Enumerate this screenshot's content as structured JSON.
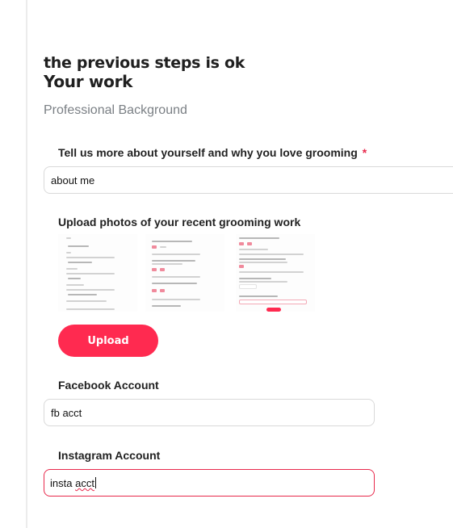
{
  "header": {
    "line1": "the previous steps is ok",
    "line2": "Your work"
  },
  "section": {
    "subtitle": "Professional Background"
  },
  "fields": {
    "about": {
      "label": "Tell us more about yourself and why you love grooming",
      "required_mark": "*",
      "value": "about me"
    },
    "photos": {
      "label": "Upload photos of your recent grooming work",
      "upload_label": "Upload"
    },
    "facebook": {
      "label": "Facebook Account",
      "value": "fb acct"
    },
    "instagram": {
      "label": "Instagram Account",
      "value_word1": "insta",
      "value_word2": "acct"
    }
  },
  "colors": {
    "accent": "#ff2a50",
    "error_border": "#e8294c",
    "muted_text": "#7a7f84"
  }
}
